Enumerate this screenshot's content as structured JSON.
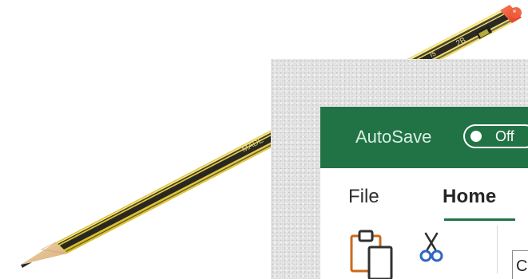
{
  "titlebar": {
    "autosave_label": "AutoSave",
    "toggle_state_label": "Off",
    "background_color": "#217346"
  },
  "ribbon": {
    "tabs": [
      {
        "label": "File",
        "active": false
      },
      {
        "label": "Home",
        "active": true
      }
    ],
    "font_box_text": "C",
    "icons": {
      "paste": "clipboard-paste-icon",
      "cut": "scissors-cut-icon"
    }
  },
  "photo": {
    "pencil_imprint_1": "MADE",
    "pencil_imprint_2": "2B",
    "pencil_imprint_3": "is"
  },
  "colors": {
    "excel_green": "#217346",
    "pencil_yellow": "#e7d24a",
    "pencil_black": "#1f1f1f",
    "pencil_cap": "#e34b2c"
  }
}
